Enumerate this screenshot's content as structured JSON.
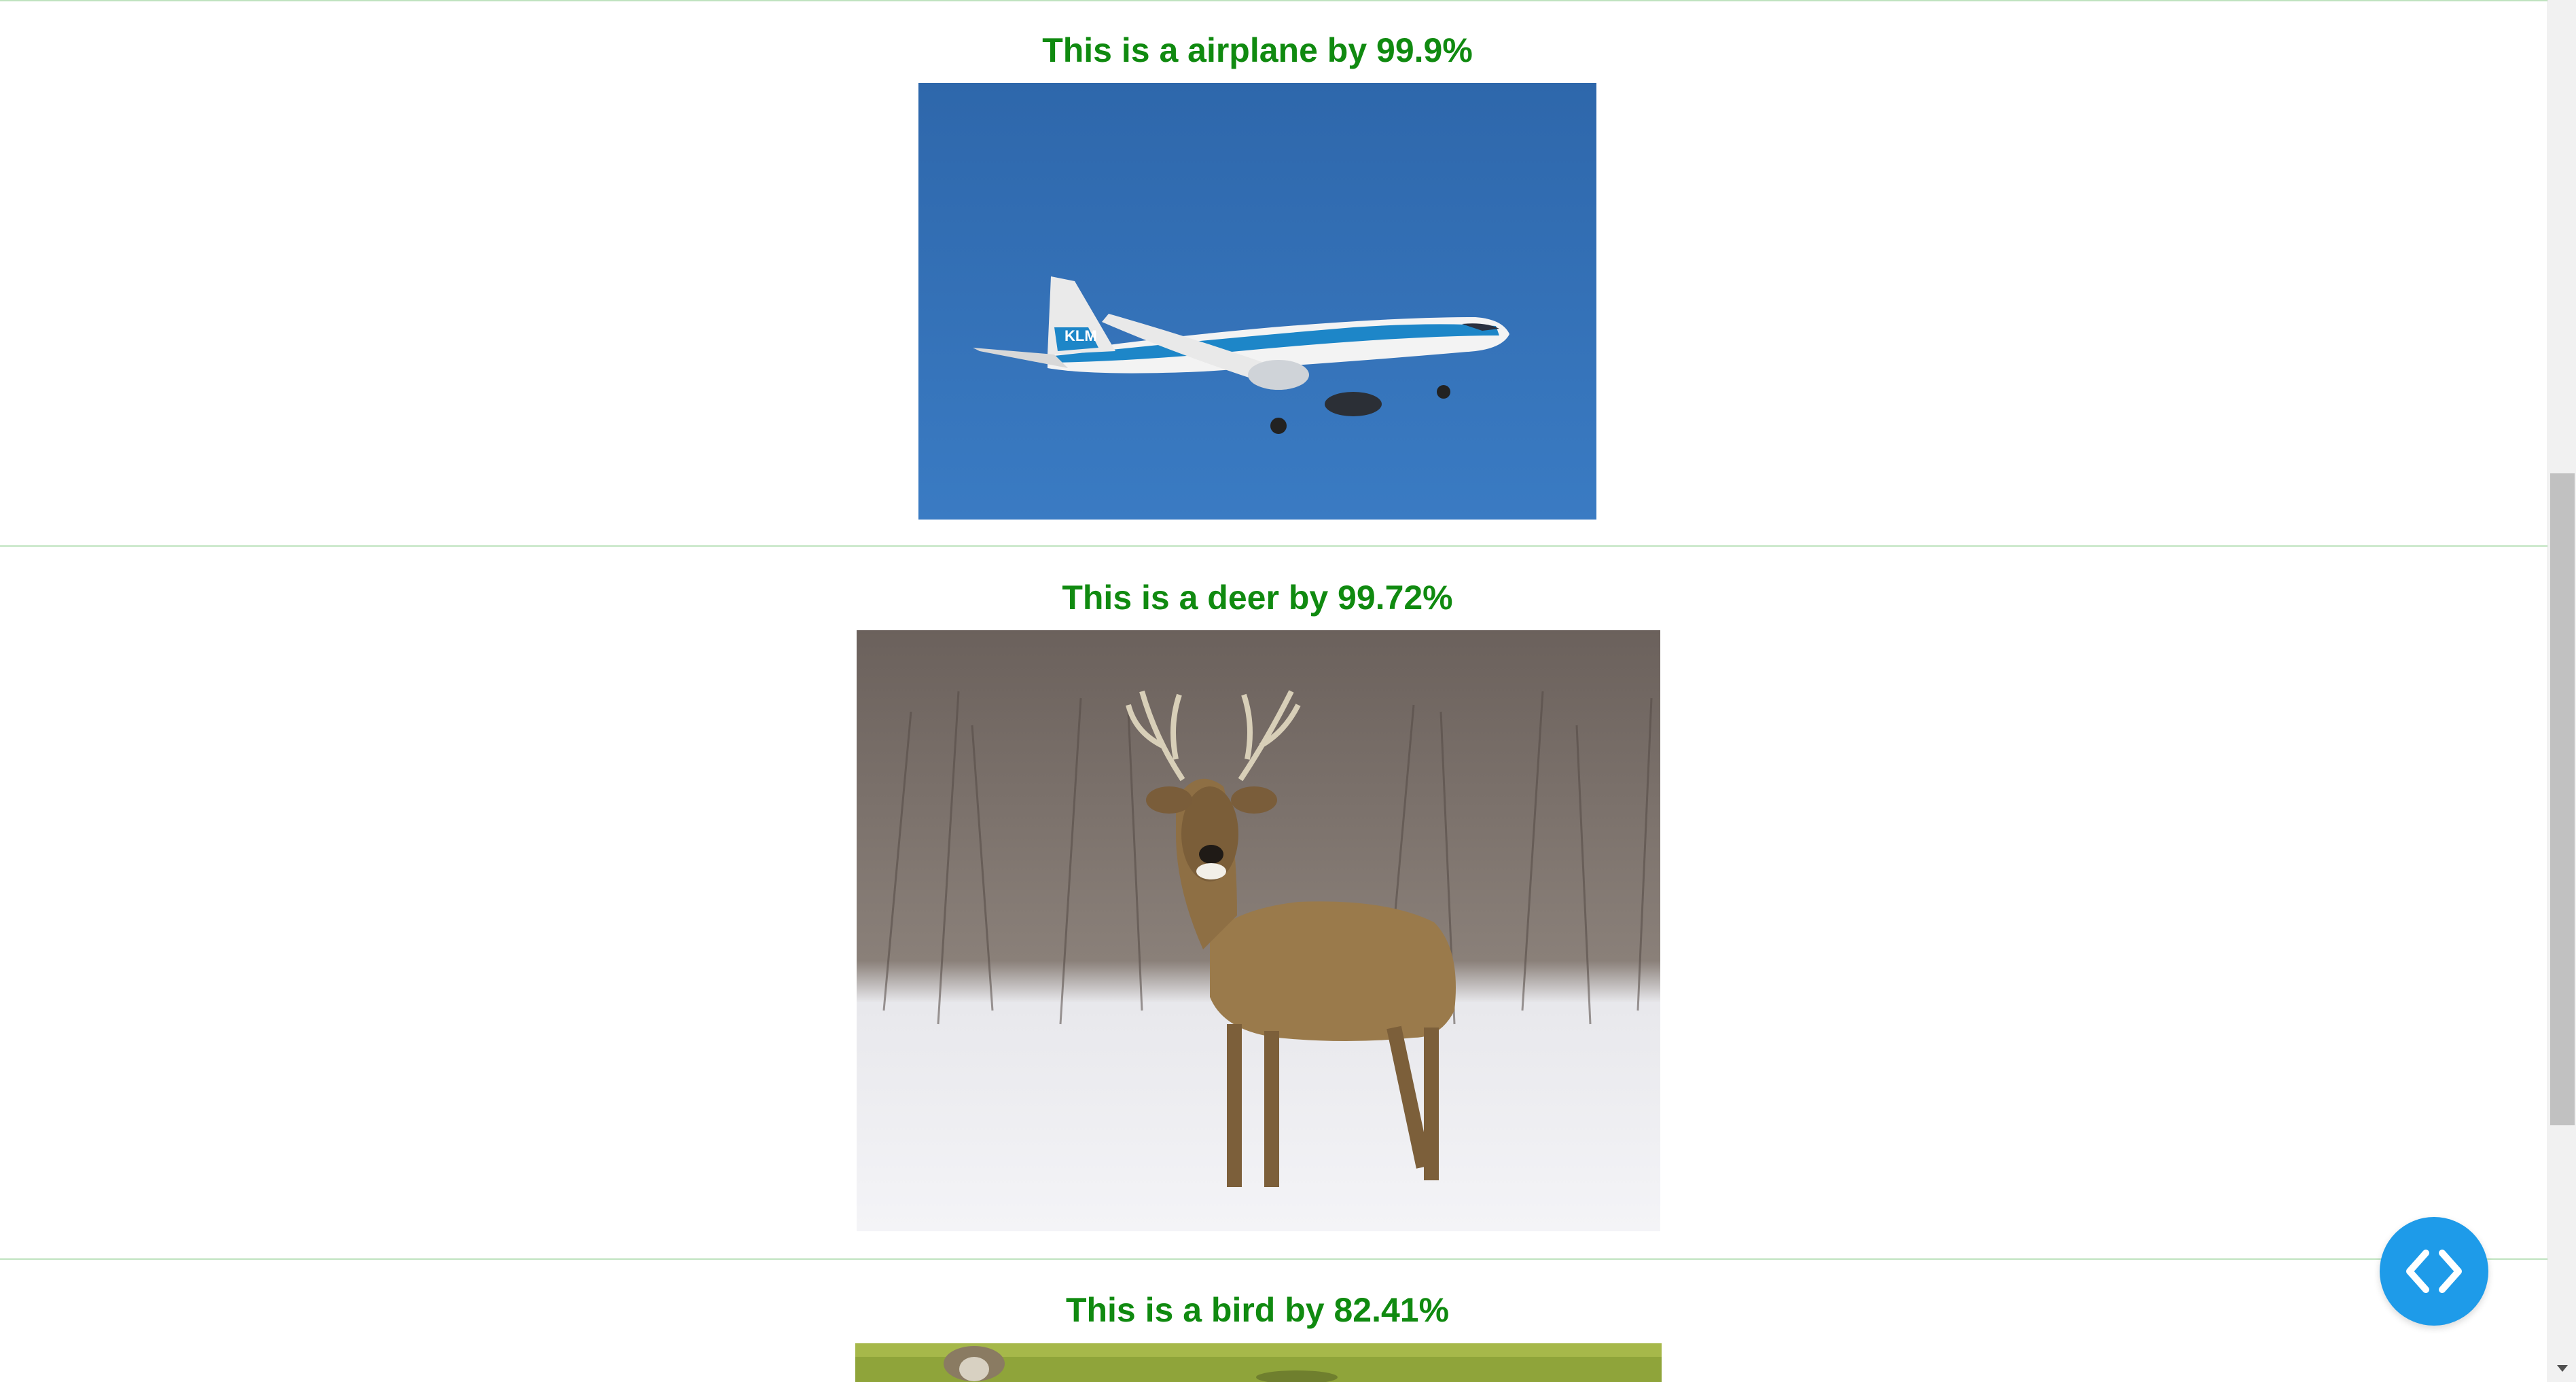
{
  "results": [
    {
      "title": "This is a airplane by 99.9%",
      "image": "airplane-photo"
    },
    {
      "title": "This is a deer by 99.72%",
      "image": "deer-photo"
    },
    {
      "title": "This is a bird by 82.41%",
      "image": "bird-photo"
    }
  ],
  "fab": {
    "icon": "code-icon"
  },
  "colors": {
    "title_text": "#108a10",
    "separator": "#bfe3bf",
    "fab": "#1e9be9",
    "sky": "#2f6fb2",
    "scroll_thumb": "#c1c1c1"
  }
}
